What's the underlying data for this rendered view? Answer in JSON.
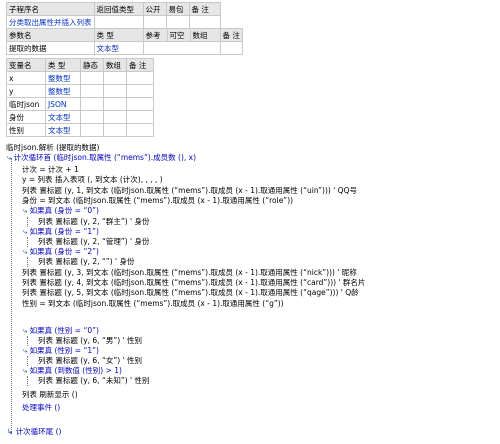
{
  "sub_table": {
    "headers": [
      "子程序名",
      "返回值类型",
      "公开",
      "易包",
      "备 注"
    ],
    "name": "分类取出属性并插入列表"
  },
  "param_table": {
    "headers": [
      "参数名",
      "类 型",
      "参考",
      "可空",
      "数组",
      "备 注"
    ],
    "rows": [
      [
        "提取的数据",
        "文本型",
        "",
        "",
        "",
        ""
      ]
    ]
  },
  "var_table": {
    "headers": [
      "变量名",
      "类 型",
      "静态",
      "数组",
      "备 注"
    ],
    "rows": [
      [
        "x",
        "整数型",
        "",
        "",
        ""
      ],
      [
        "y",
        "整数型",
        "",
        "",
        ""
      ],
      [
        "临时json",
        "JSON",
        "",
        "",
        ""
      ],
      [
        "身份",
        "文本型",
        "",
        "",
        ""
      ],
      [
        "性别",
        "文本型",
        "",
        "",
        ""
      ]
    ]
  },
  "code_lines": [
    "临时json.解析 (提取的数据)",
    "计次循环首 (临时json.取属性 (“mems”).成员数 (), x)",
    "计次 = 计次 + 1",
    "y = 列表 插入表项 (, 到文本 (计次), , , , )",
    "列表 置标题 (y, 1, 到文本 (临时json.取属性 (“mems”).取成员 (x - 1).取通用属性 (“uin”)))  ' QQ号",
    "身份 = 到文本 (临时json.取属性 (“mems”).取成员 (x - 1).取通用属性 (“role”))",
    "如果真 (身份 = “0”)",
    "列表 置标题 (y, 2, “群主”)  ' 身份",
    "如果真 (身份 = “1”)",
    "列表 置标题 (y, 2, “管理”)  ' 身份",
    "如果真 (身份 = “2”)",
    "列表 置标题 (y, 2, “”)  ' 身份",
    "列表 置标题 (y, 3, 到文本 (临时json.取属性 (“mems”).取成员 (x - 1).取通用属性 (“nick”)))  ' 昵称",
    "列表 置标题 (y, 4, 到文本 (临时json.取属性 (“mems”).取成员 (x - 1).取通用属性 (“card”)))  ' 群名片",
    "列表 置标题 (y, 5, 到文本 (临时json.取属性 (“mems”).取成员 (x - 1).取通用属性 (“qage”)))  ' Q龄",
    "性别 = 到文本 (临时json.取属性 (“mems”).取成员 (x - 1).取通用属性 (“g”))",
    "如果真 (性别 = “0”)",
    "列表 置标题 (y, 6, “男”)  ' 性别",
    "如果真 (性别 = “1”)",
    "列表 置标题 (y, 6, “女”)  ' 性别",
    "如果真 (到数值 (性别) > 1)",
    "列表 置标题 (y, 6, “未知”)  ' 性别",
    "列表 刷新显示 ()",
    "处理事件 ()",
    "计次循环尾 ()"
  ]
}
